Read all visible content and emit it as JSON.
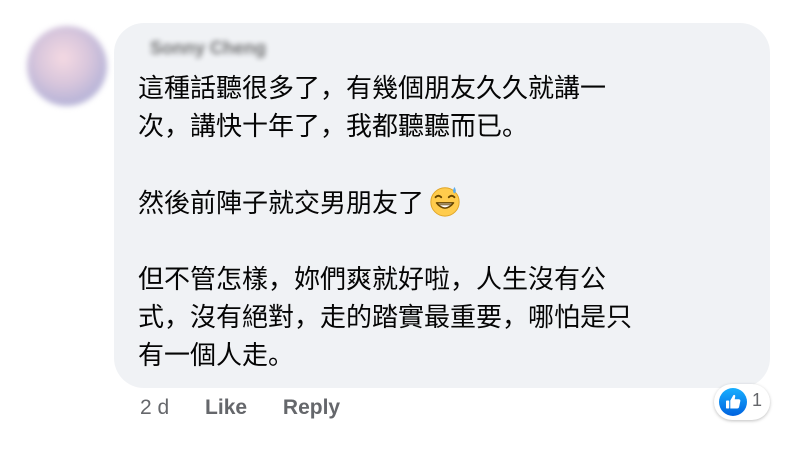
{
  "comment": {
    "author": "Sonny Cheng",
    "paragraphs": [
      [
        "這種話聽很多了，有幾個朋友久久就講一",
        "次，講快十年了，我都聽聽而已。"
      ],
      [
        "然後前陣子就交男朋友了"
      ],
      [
        "但不管怎樣，妳們爽就好啦，人生沒有公",
        "式，沒有絕對，走的踏實最重要，哪怕是只",
        "有一個人走。"
      ]
    ],
    "emoji": "grinning-face-with-sweat-icon"
  },
  "actions": {
    "time": "2 d",
    "like_label": "Like",
    "reply_label": "Reply"
  },
  "reactions": {
    "icon": "like-icon",
    "count": "1"
  },
  "colors": {
    "bubble": "#f0f2f5",
    "text": "#050505",
    "meta": "#65676b",
    "like_blue": "#1877f2"
  }
}
